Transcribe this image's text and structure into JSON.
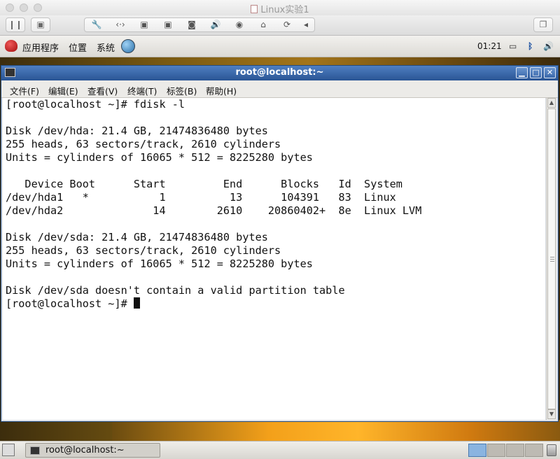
{
  "vm_window": {
    "title": "Linux实验1",
    "toolbar_icons": [
      "pause-icon",
      "snapshot-icon",
      "wrench-icon",
      "arrows-icon",
      "floppy-icon",
      "disk-icon",
      "hdd-icon",
      "sound-icon",
      "camera-icon",
      "mouse-icon",
      "refresh-icon",
      "arrow-left-icon",
      "window-icon"
    ]
  },
  "gnome_panel": {
    "menus": [
      "应用程序",
      "位置",
      "系统"
    ],
    "clock": "01:21"
  },
  "terminal": {
    "title": "root@localhost:~",
    "menu": [
      "文件(F)",
      "编辑(E)",
      "查看(V)",
      "终端(T)",
      "标签(B)",
      "帮助(H)"
    ],
    "lines": [
      "[root@localhost ~]# fdisk -l",
      "",
      "Disk /dev/hda: 21.4 GB, 21474836480 bytes",
      "255 heads, 63 sectors/track, 2610 cylinders",
      "Units = cylinders of 16065 * 512 = 8225280 bytes",
      "",
      "   Device Boot      Start         End      Blocks   Id  System",
      "/dev/hda1   *           1          13      104391   83  Linux",
      "/dev/hda2              14        2610    20860402+  8e  Linux LVM",
      "",
      "Disk /dev/sda: 21.4 GB, 21474836480 bytes",
      "255 heads, 63 sectors/track, 2610 cylinders",
      "Units = cylinders of 16065 * 512 = 8225280 bytes",
      "",
      "Disk /dev/sda doesn't contain a valid partition table",
      "[root@localhost ~]# "
    ]
  },
  "taskbar": {
    "task_label": "root@localhost:~"
  },
  "colors": {
    "title_bar": "#2a5595",
    "terminal_bg": "#ffffff",
    "terminal_fg": "#111111"
  }
}
